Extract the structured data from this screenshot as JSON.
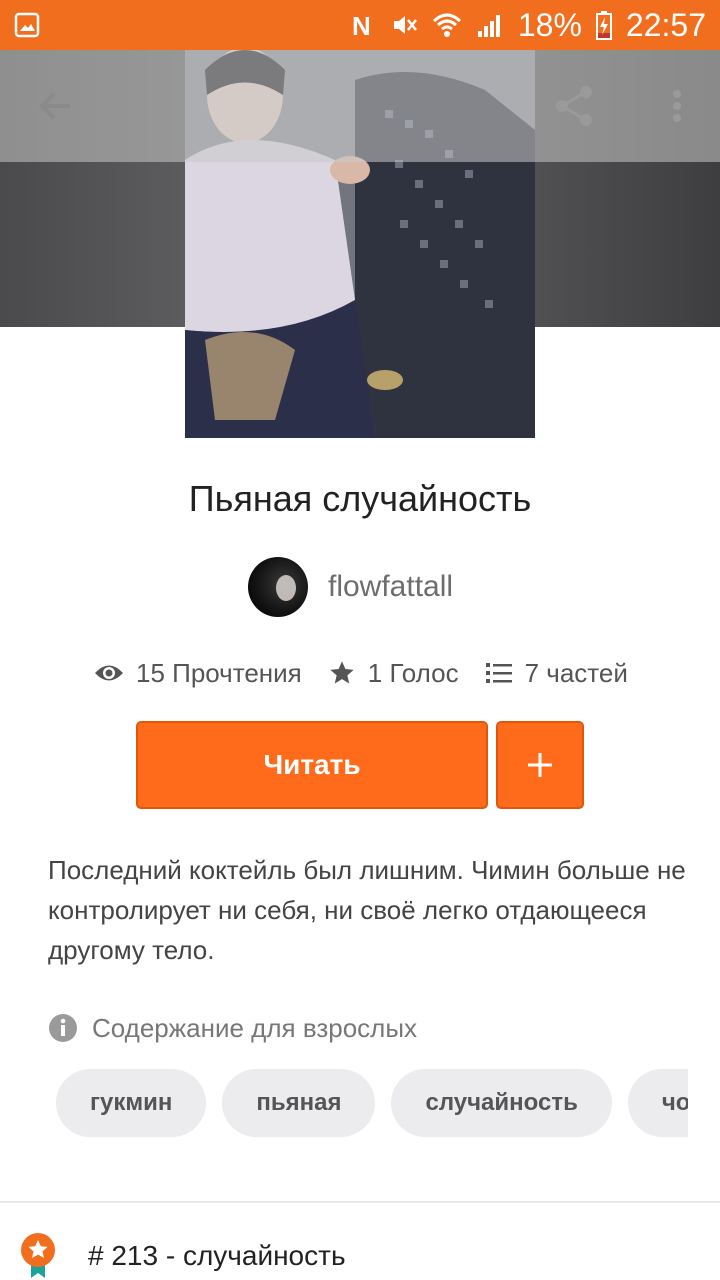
{
  "status_bar": {
    "battery": "18%",
    "time": "22:57"
  },
  "story": {
    "title": "Пьяная случайность",
    "author": "flowfattall",
    "stats": {
      "reads": "15 Прочтения",
      "votes": "1 Голос",
      "parts": "7 частей"
    },
    "read_label": "Читать",
    "add_label": "+",
    "description": "Последний коктейль был лишним. Чимин больше не контролирует ни себя, ни своё легко отдающееся другому тело.",
    "mature_label": "Содержание для взрослых",
    "tags": [
      "гукмин",
      "пьяная",
      "случайность",
      "чонгуки"
    ],
    "ranking": "# 213 - случайность"
  },
  "colors": {
    "accent": "#ff6b1a",
    "status_bar": "#f26e1f"
  },
  "icons": {
    "back": "arrow-back-icon",
    "share": "share-icon",
    "more": "more-vert-icon",
    "reads": "eye-icon",
    "votes": "star-icon",
    "parts": "list-icon",
    "mature": "info-icon",
    "ranking": "ranking-badge-icon"
  }
}
